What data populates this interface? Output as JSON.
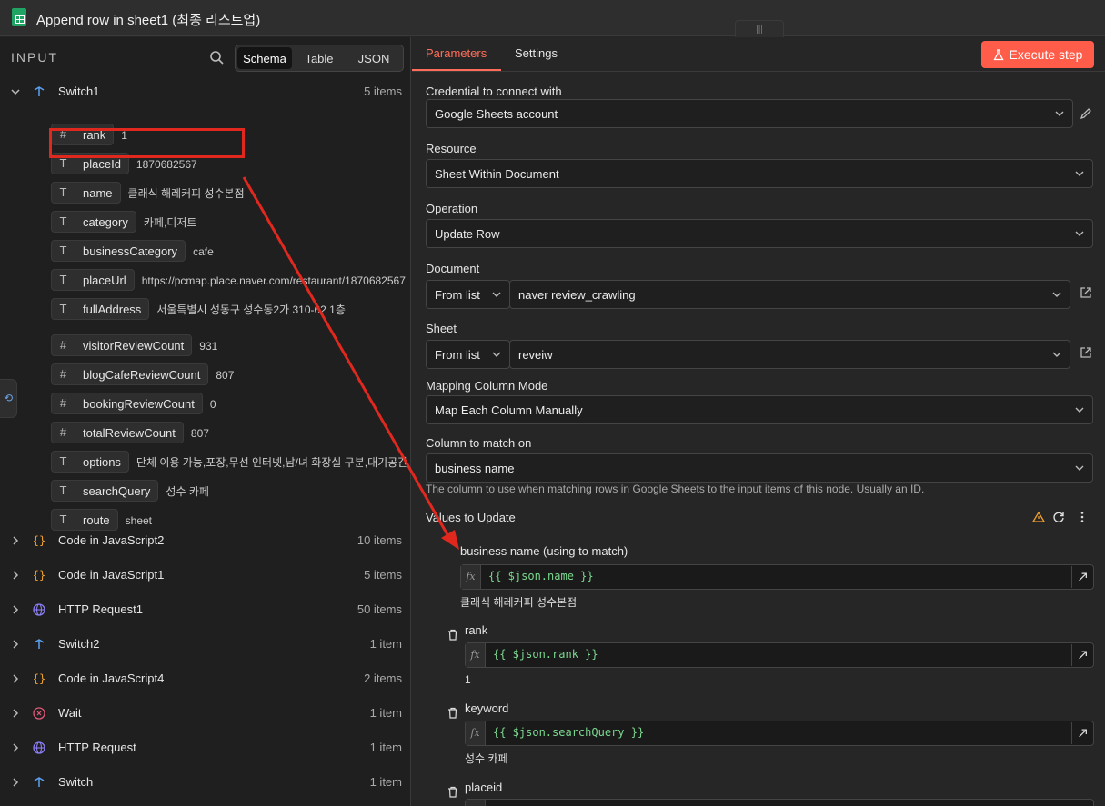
{
  "window": {
    "title": "Append row in sheet1 (최종 리스트업)",
    "handle": "|||"
  },
  "input_panel": {
    "label": "INPUT",
    "view_tabs": [
      "Schema",
      "Table",
      "JSON"
    ],
    "nodes_top": {
      "name": "Switch1",
      "count": "5 items"
    },
    "fields": [
      {
        "type": "#",
        "name": "rank",
        "value": "1"
      },
      {
        "type": "T",
        "name": "placeId",
        "value": "1870682567"
      },
      {
        "type": "T",
        "name": "name",
        "value": "클래식 해레커피 성수본점"
      },
      {
        "type": "T",
        "name": "category",
        "value": "카페,디저트"
      },
      {
        "type": "T",
        "name": "businessCategory",
        "value": "cafe"
      },
      {
        "type": "T",
        "name": "placeUrl",
        "value": "https://pcmap.place.naver.com/restaurant/1870682567"
      },
      {
        "type": "T",
        "name": "fullAddress",
        "value": "서울특별시 성동구 성수동2가 310-62 1층"
      },
      {
        "type": "#",
        "name": "visitorReviewCount",
        "value": "931"
      },
      {
        "type": "#",
        "name": "blogCafeReviewCount",
        "value": "807"
      },
      {
        "type": "#",
        "name": "bookingReviewCount",
        "value": "0"
      },
      {
        "type": "#",
        "name": "totalReviewCount",
        "value": "807"
      },
      {
        "type": "T",
        "name": "options",
        "value": "단체 이용 가능,포장,무선 인터넷,남/녀 화장실 구분,대기공간"
      },
      {
        "type": "T",
        "name": "searchQuery",
        "value": "성수 카페"
      },
      {
        "type": "T",
        "name": "route",
        "value": "sheet"
      }
    ],
    "nodes": [
      {
        "icon": "{}",
        "name": "Code in JavaScript2",
        "count": "10 items"
      },
      {
        "icon": "{}",
        "name": "Code in JavaScript1",
        "count": "5 items"
      },
      {
        "icon": "globe",
        "name": "HTTP Request1",
        "count": "50 items"
      },
      {
        "icon": "switch",
        "name": "Switch2",
        "count": "1 item"
      },
      {
        "icon": "{}",
        "name": "Code in JavaScript4",
        "count": "2 items"
      },
      {
        "icon": "wait",
        "name": "Wait",
        "count": "1 item"
      },
      {
        "icon": "globe",
        "name": "HTTP Request",
        "count": "1 item"
      },
      {
        "icon": "switch",
        "name": "Switch",
        "count": "1 item"
      }
    ]
  },
  "params_panel": {
    "tabs": [
      "Parameters",
      "Settings"
    ],
    "execute_label": "Execute step",
    "credential": {
      "label": "Credential to connect with",
      "value": "Google Sheets account"
    },
    "resource": {
      "label": "Resource",
      "value": "Sheet Within Document"
    },
    "operation": {
      "label": "Operation",
      "value": "Update Row"
    },
    "document": {
      "label": "Document",
      "mode": "From list",
      "value": "naver review_crawling"
    },
    "sheet": {
      "label": "Sheet",
      "mode": "From list",
      "value": "reveiw"
    },
    "mapping_mode": {
      "label": "Mapping Column Mode",
      "value": "Map Each Column Manually"
    },
    "match_column": {
      "label": "Column to match on",
      "value": "business name",
      "hint": "The column to use when matching rows in Google Sheets to the input items of this node. Usually an ID."
    },
    "values_header": "Values to Update",
    "mappings": [
      {
        "label": "business name (using to match)",
        "expr": "{{ $json.name }}",
        "preview": "클래식  해레커피  성수본점"
      },
      {
        "label": "rank",
        "expr": "{{ $json.rank }}",
        "preview": "1"
      },
      {
        "label": "keyword",
        "expr": "{{ $json.searchQuery }}",
        "preview": "성수  카페"
      },
      {
        "label": "placeid",
        "expr": "",
        "preview": ""
      }
    ],
    "fx_label": "fx"
  },
  "colors": {
    "accent": "#ff6d5a",
    "annotation": "#e0281f",
    "expression": "#7bd88f"
  }
}
